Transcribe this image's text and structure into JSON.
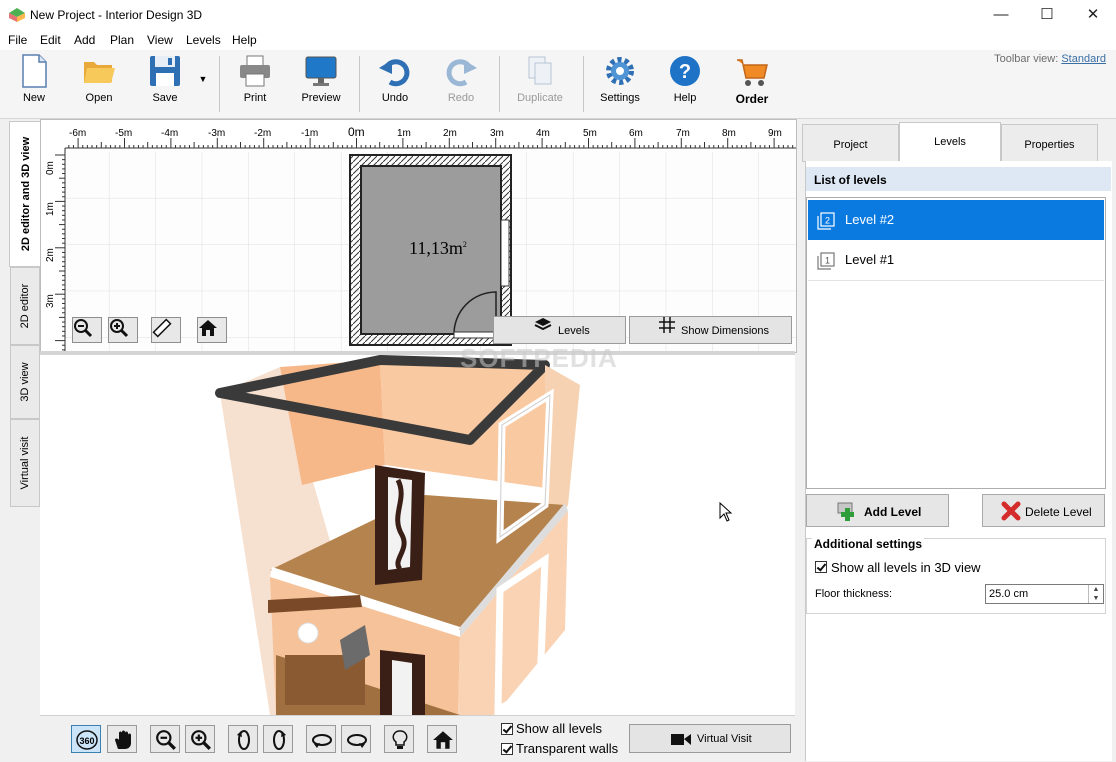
{
  "window": {
    "title": "New Project - Interior Design 3D",
    "controls": {
      "minimize": "—",
      "maximize": "☐",
      "close": "✕"
    }
  },
  "menu": [
    "File",
    "Edit",
    "Add",
    "Plan",
    "View",
    "Levels",
    "Help"
  ],
  "toolbar": {
    "view_label": "Toolbar view:",
    "view_value": "Standard",
    "buttons": {
      "new": "New",
      "open": "Open",
      "save": "Save",
      "print": "Print",
      "preview": "Preview",
      "undo": "Undo",
      "redo": "Redo",
      "duplicate": "Duplicate",
      "settings": "Settings",
      "help": "Help",
      "order": "Order"
    }
  },
  "side_tabs": [
    "2D editor and 3D view",
    "2D editor",
    "3D view",
    "Virtual visit"
  ],
  "editor2d": {
    "ruler_h": [
      "-6m",
      "-5m",
      "-4m",
      "-3m",
      "-2m",
      "-1m",
      "0m",
      "1m",
      "2m",
      "3m",
      "4m",
      "5m",
      "6m",
      "7m",
      "8m",
      "9m"
    ],
    "ruler_v": [
      "0m",
      "1m",
      "2m",
      "3m"
    ],
    "room_area": "11,13m",
    "room_area_sup": "2",
    "levels_button": "Levels",
    "dimensions_button": "Show Dimensions"
  },
  "watermark": "SOFTPEDIA",
  "view3d_bar": {
    "rotate_label": "360",
    "show_all_levels": "Show all levels",
    "transparent_walls": "Transparent walls",
    "virtual_visit": "Virtual Visit"
  },
  "right_panel": {
    "tabs": [
      "Project",
      "Levels",
      "Properties"
    ],
    "list_title": "List of levels",
    "levels": [
      {
        "icon_num": "2",
        "name": "Level #2",
        "selected": true
      },
      {
        "icon_num": "1",
        "name": "Level #1",
        "selected": false
      }
    ],
    "add_level": "Add Level",
    "delete_level": "Delete Level",
    "additional_title": "Additional settings",
    "show_all_levels_3d": "Show all levels in 3D view",
    "floor_thickness_label": "Floor thickness:",
    "floor_thickness_value": "25.0 cm"
  }
}
